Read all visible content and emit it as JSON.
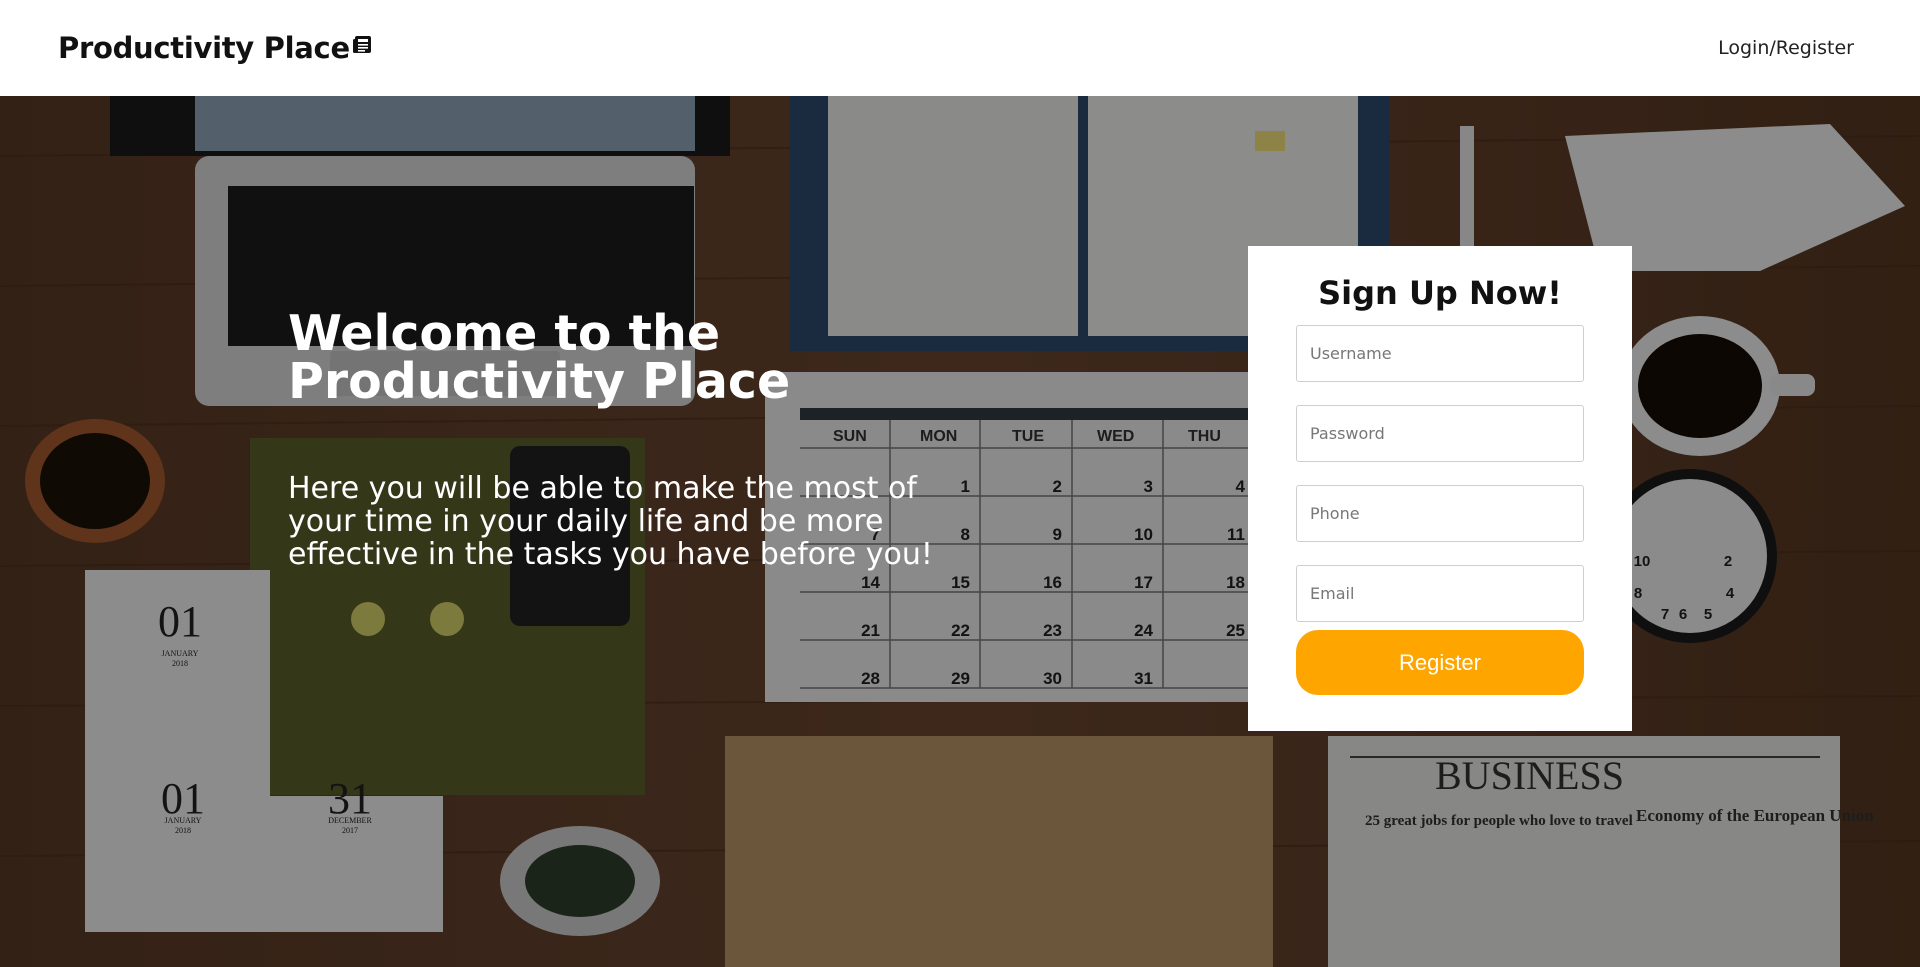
{
  "nav": {
    "brand": "Productivity Place",
    "brand_icon": "newspaper-icon",
    "login_link": "Login/Register"
  },
  "hero": {
    "title_line1": "Welcome to the",
    "title_line2": "Productivity Place",
    "description": "Here you will be able to make the most of your time in your daily life and be more effective in the tasks you have before you!"
  },
  "signup": {
    "title": "Sign Up Now!",
    "username_placeholder": "Username",
    "password_placeholder": "Password",
    "phone_placeholder": "Phone",
    "email_placeholder": "Email",
    "register_label": "Register"
  },
  "background": {
    "calendar_days": [
      "SUN",
      "MON",
      "TUE",
      "WED",
      "THU"
    ],
    "calendar_rows": [
      [
        "",
        "1",
        "2",
        "3",
        "4"
      ],
      [
        "7",
        "8",
        "9",
        "10",
        "11"
      ],
      [
        "14",
        "15",
        "16",
        "17",
        "18"
      ],
      [
        "21",
        "22",
        "23",
        "24",
        "25"
      ],
      [
        "28",
        "29",
        "30",
        "31",
        ""
      ]
    ],
    "notepad1_number": "01",
    "notepad1_month": "JANUARY",
    "notepad1_year": "2018",
    "notepad2_number": "01",
    "notepad2_month": "JANUARY",
    "notepad2_year": "2018",
    "notepad3_number": "31",
    "notepad3_month": "DECEMBER",
    "notepad3_year": "2017",
    "newspaper_masthead": "BUSINESS",
    "newspaper_headline1": "25 great jobs for people who love to travel",
    "newspaper_headline2": "Economy of the European Union",
    "clock_numbers": [
      "10",
      "2",
      "8",
      "4",
      "7",
      "6",
      "5"
    ]
  },
  "colors": {
    "accent": "#FFA500",
    "header_bg": "#ffffff",
    "card_bg": "#ffffff"
  }
}
